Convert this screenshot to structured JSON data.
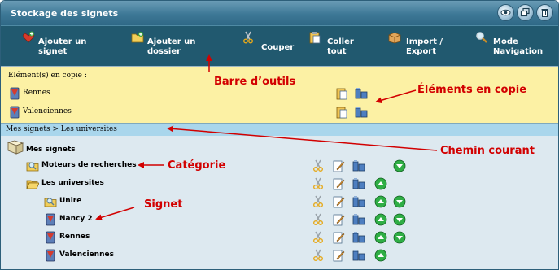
{
  "window": {
    "title": "Stockage des signets",
    "buttons": [
      "eye-icon",
      "restore-window-icon",
      "trash-icon"
    ]
  },
  "toolbar": {
    "items": [
      {
        "label": "Ajouter un\nsignet",
        "icon": "add-bookmark-icon"
      },
      {
        "label": "Ajouter un\ndossier",
        "icon": "add-folder-icon"
      },
      {
        "label": "Couper",
        "icon": "scissors-icon"
      },
      {
        "label": "Coller\ntout",
        "icon": "paste-icon"
      },
      {
        "label": "Import /\nExport",
        "icon": "box-icon"
      },
      {
        "label": "Mode\nNavigation",
        "icon": "magnifier-icon"
      }
    ]
  },
  "clipboard": {
    "header": "Elément(s) en copie :",
    "items": [
      {
        "label": "Rennes"
      },
      {
        "label": "Valenciennes"
      }
    ]
  },
  "breadcrumb": {
    "text": "Mes signets > Les universites"
  },
  "tree": {
    "root": "Mes signets",
    "nodes": [
      {
        "label": "Moteurs de recherches",
        "kind": "category",
        "actions": [
          "cut",
          "edit",
          "delete",
          "down"
        ]
      },
      {
        "label": "Les universites",
        "kind": "folder-open",
        "actions": [
          "cut",
          "edit",
          "delete",
          "up"
        ]
      },
      {
        "label": "Unire",
        "kind": "category",
        "actions": [
          "cut",
          "edit",
          "delete",
          "up",
          "down"
        ]
      },
      {
        "label": "Nancy 2",
        "kind": "bookmark",
        "actions": [
          "cut",
          "edit",
          "delete",
          "up",
          "down"
        ]
      },
      {
        "label": "Rennes",
        "kind": "bookmark",
        "actions": [
          "cut",
          "edit",
          "delete",
          "up",
          "down"
        ]
      },
      {
        "label": "Valenciennes",
        "kind": "bookmark",
        "actions": [
          "cut",
          "edit",
          "delete",
          "up"
        ]
      }
    ]
  },
  "annotations": {
    "toolbar": "Barre d’outils",
    "clipboard": "Éléments en copie",
    "path": "Chemin courant",
    "category": "Catégorie",
    "bookmark": "Signet"
  },
  "colors": {
    "titlebar": "#3d7896",
    "toolbar": "#21596f",
    "clipboard_bg": "#fcf1a4",
    "breadcrumb_bg": "#a9d6ec",
    "tree_bg": "#dde9f0",
    "annotation": "#d20000",
    "arrow_up": "#1fa23a"
  }
}
